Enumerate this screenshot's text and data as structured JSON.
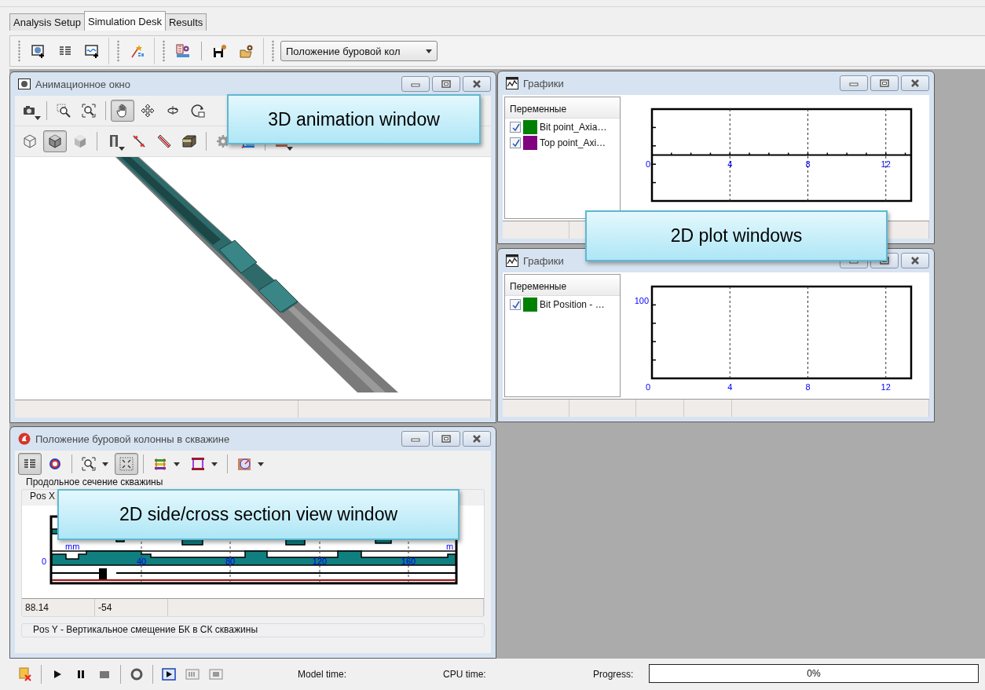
{
  "tabs": [
    {
      "label": "Analysis Setup",
      "selected": false
    },
    {
      "label": "Simulation Desk",
      "selected": true
    },
    {
      "label": "Results",
      "selected": false
    }
  ],
  "toolbar": {
    "dropdown": "Положение буровой кол"
  },
  "windows": [
    {
      "kind": "animation",
      "title": "Анимационное окно",
      "tool_rows": [
        [
          {
            "pressed": false
          },
          {
            "pressed": false
          },
          {
            "pressed": false
          },
          {
            "pressed": true
          },
          {
            "pressed": false
          },
          {
            "pressed": false
          },
          {
            "pressed": false
          }
        ],
        [
          {
            "pressed": false
          },
          {
            "pressed": true
          },
          {
            "pressed": false
          },
          {
            "pressed": false
          },
          {
            "pressed": false
          },
          {
            "pressed": false
          },
          {
            "pressed": false
          },
          {
            "pressed": false
          },
          {
            "pressed": false
          },
          {
            "pressed": false
          }
        ]
      ]
    },
    {
      "kind": "plot",
      "title": "Графики",
      "variables_header": "Переменные",
      "variables": [
        {
          "name": "Bit point_Axia…",
          "checked": true,
          "color": "#008000"
        },
        {
          "name": "Top point_Axi…",
          "checked": true,
          "color": "#800080"
        }
      ],
      "x_tick_labels": [
        "0",
        "4",
        "8",
        "12"
      ]
    },
    {
      "kind": "plot",
      "title": "Графики",
      "variables_header": "Переменные",
      "variables": [
        {
          "name": "Bit Position - …",
          "checked": true,
          "color": "#008000"
        }
      ],
      "x_tick_labels": [
        "0",
        "4",
        "8",
        "12"
      ],
      "y_tick_labels": [
        "100"
      ]
    },
    {
      "kind": "section",
      "title": "Положение буровой колонны в скважине",
      "tools": [
        {
          "pressed": true
        },
        {
          "pressed": false
        },
        {
          "pressed": false
        },
        {
          "pressed": true
        },
        {
          "pressed": false
        },
        {
          "pressed": false
        },
        {
          "pressed": false
        }
      ],
      "group_label": "Продольное сечение скважины",
      "panel_label": "Pos X",
      "profile": {
        "unit_left": "mm",
        "unit_right": "m",
        "y_label": "0",
        "x_labels": [
          "40",
          "80",
          "120",
          "160"
        ]
      },
      "readouts": [
        "88.14",
        "-54"
      ],
      "footer_label": "Pos Y - Вертикальное смещение БК в СК скважины"
    }
  ],
  "callouts": [
    "3D animation window",
    "2D plot windows",
    "2D side/cross section view window"
  ],
  "status_bar": {
    "model_time_label": "Model time:",
    "cpu_time_label": "CPU time:",
    "progress_label": "Progress:",
    "progress_value": "0%",
    "level": 0
  }
}
